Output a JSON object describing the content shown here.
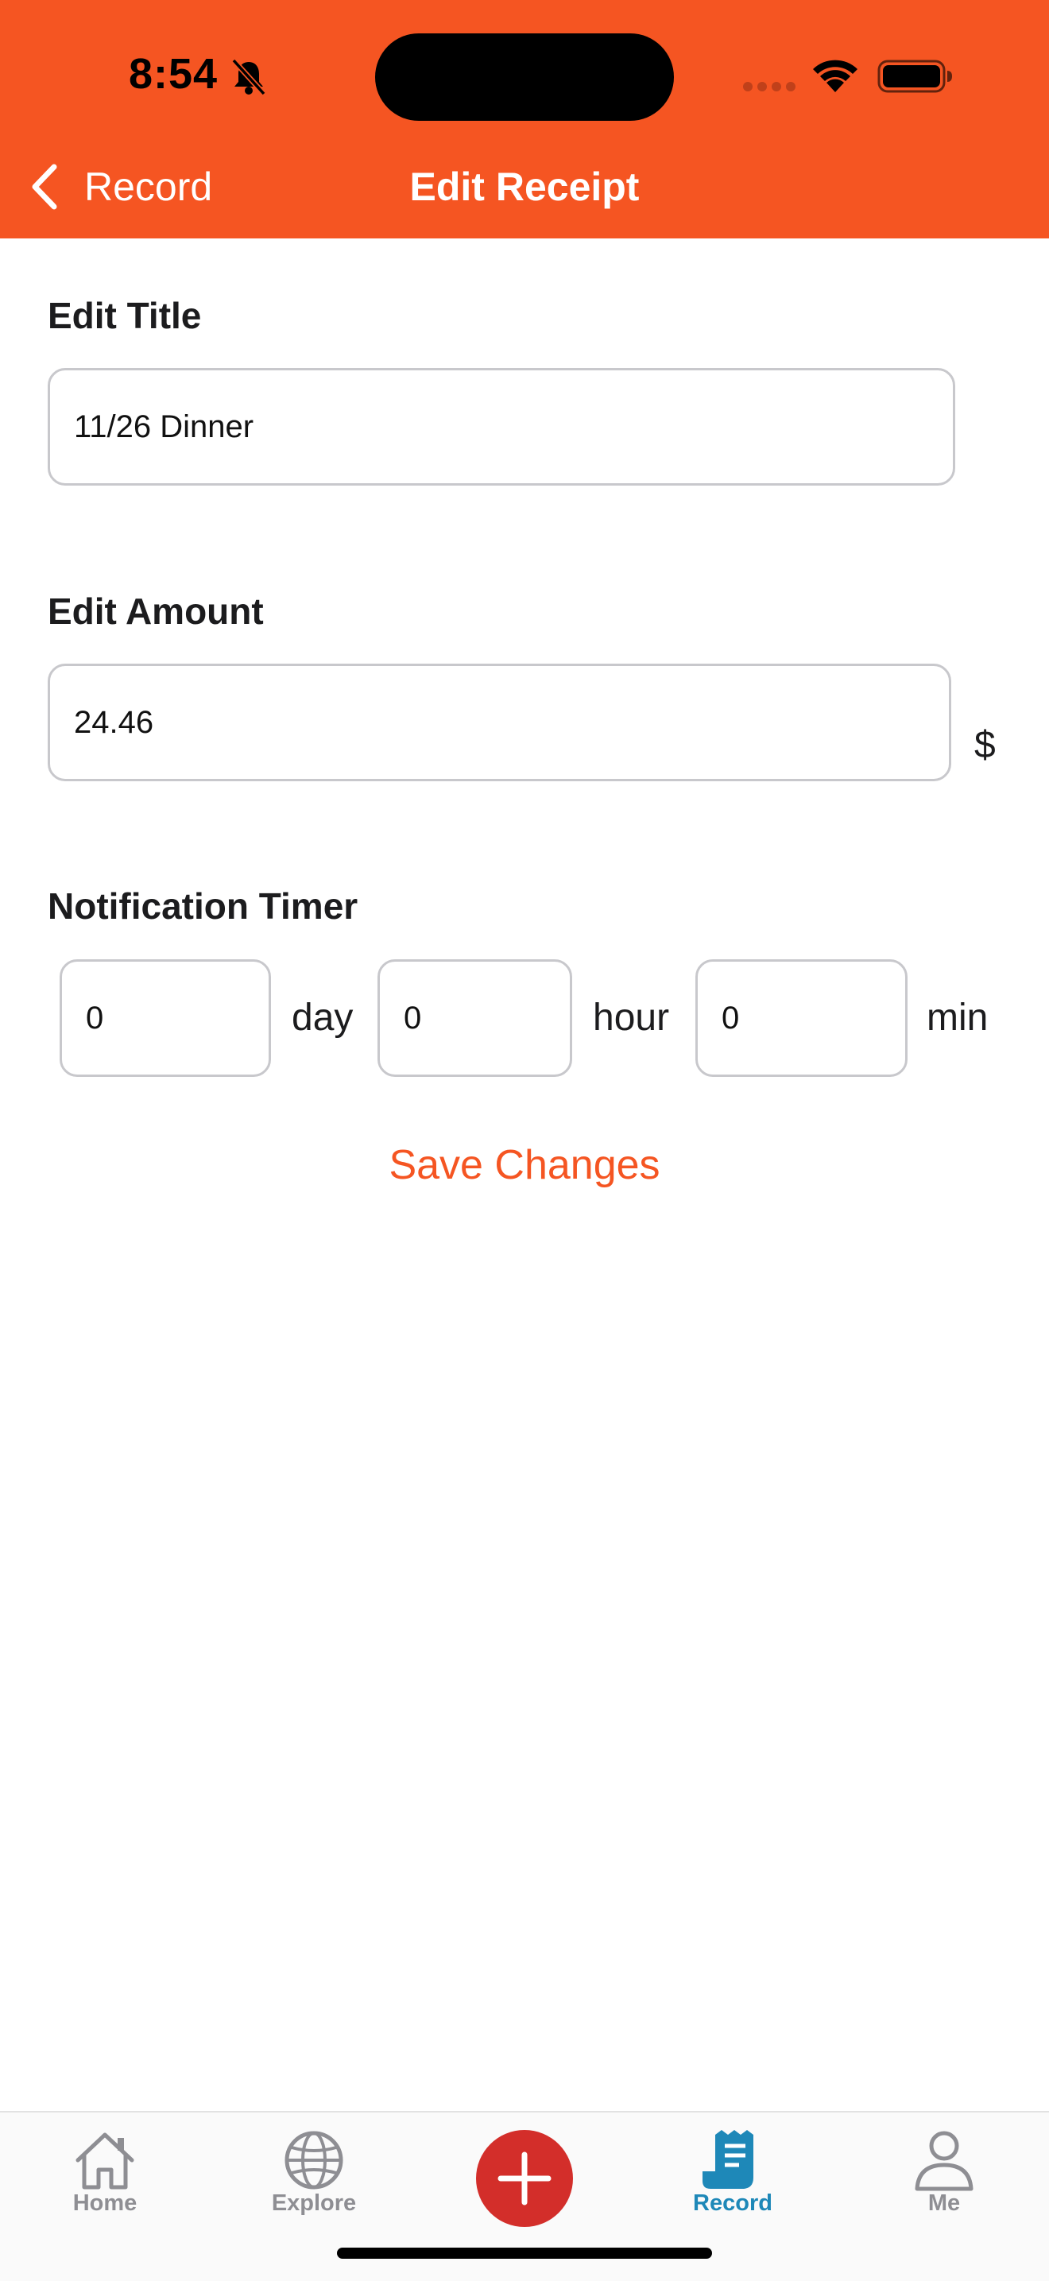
{
  "status_bar": {
    "time": "8:54"
  },
  "nav": {
    "back_label": "Record",
    "title": "Edit Receipt"
  },
  "form": {
    "title_label": "Edit Title",
    "title_value": "11/26 Dinner",
    "amount_label": "Edit Amount",
    "amount_value": "24.46",
    "currency": "$",
    "timer_label": "Notification Timer",
    "day_value": "0",
    "day_unit": "day",
    "hour_value": "0",
    "hour_unit": "hour",
    "min_value": "0",
    "min_unit": "min",
    "save_label": "Save Changes"
  },
  "tabbar": {
    "items": [
      {
        "label": "Home",
        "icon": "home-icon",
        "active": false
      },
      {
        "label": "Explore",
        "icon": "globe-icon",
        "active": false
      },
      {
        "label": "",
        "icon": "plus-icon",
        "active": false
      },
      {
        "label": "Record",
        "icon": "receipt-icon",
        "active": true
      },
      {
        "label": "Me",
        "icon": "person-icon",
        "active": false
      }
    ]
  },
  "colors": {
    "brand": "#f55522",
    "active_tab": "#1e88b8",
    "fab": "#d32e2a"
  }
}
